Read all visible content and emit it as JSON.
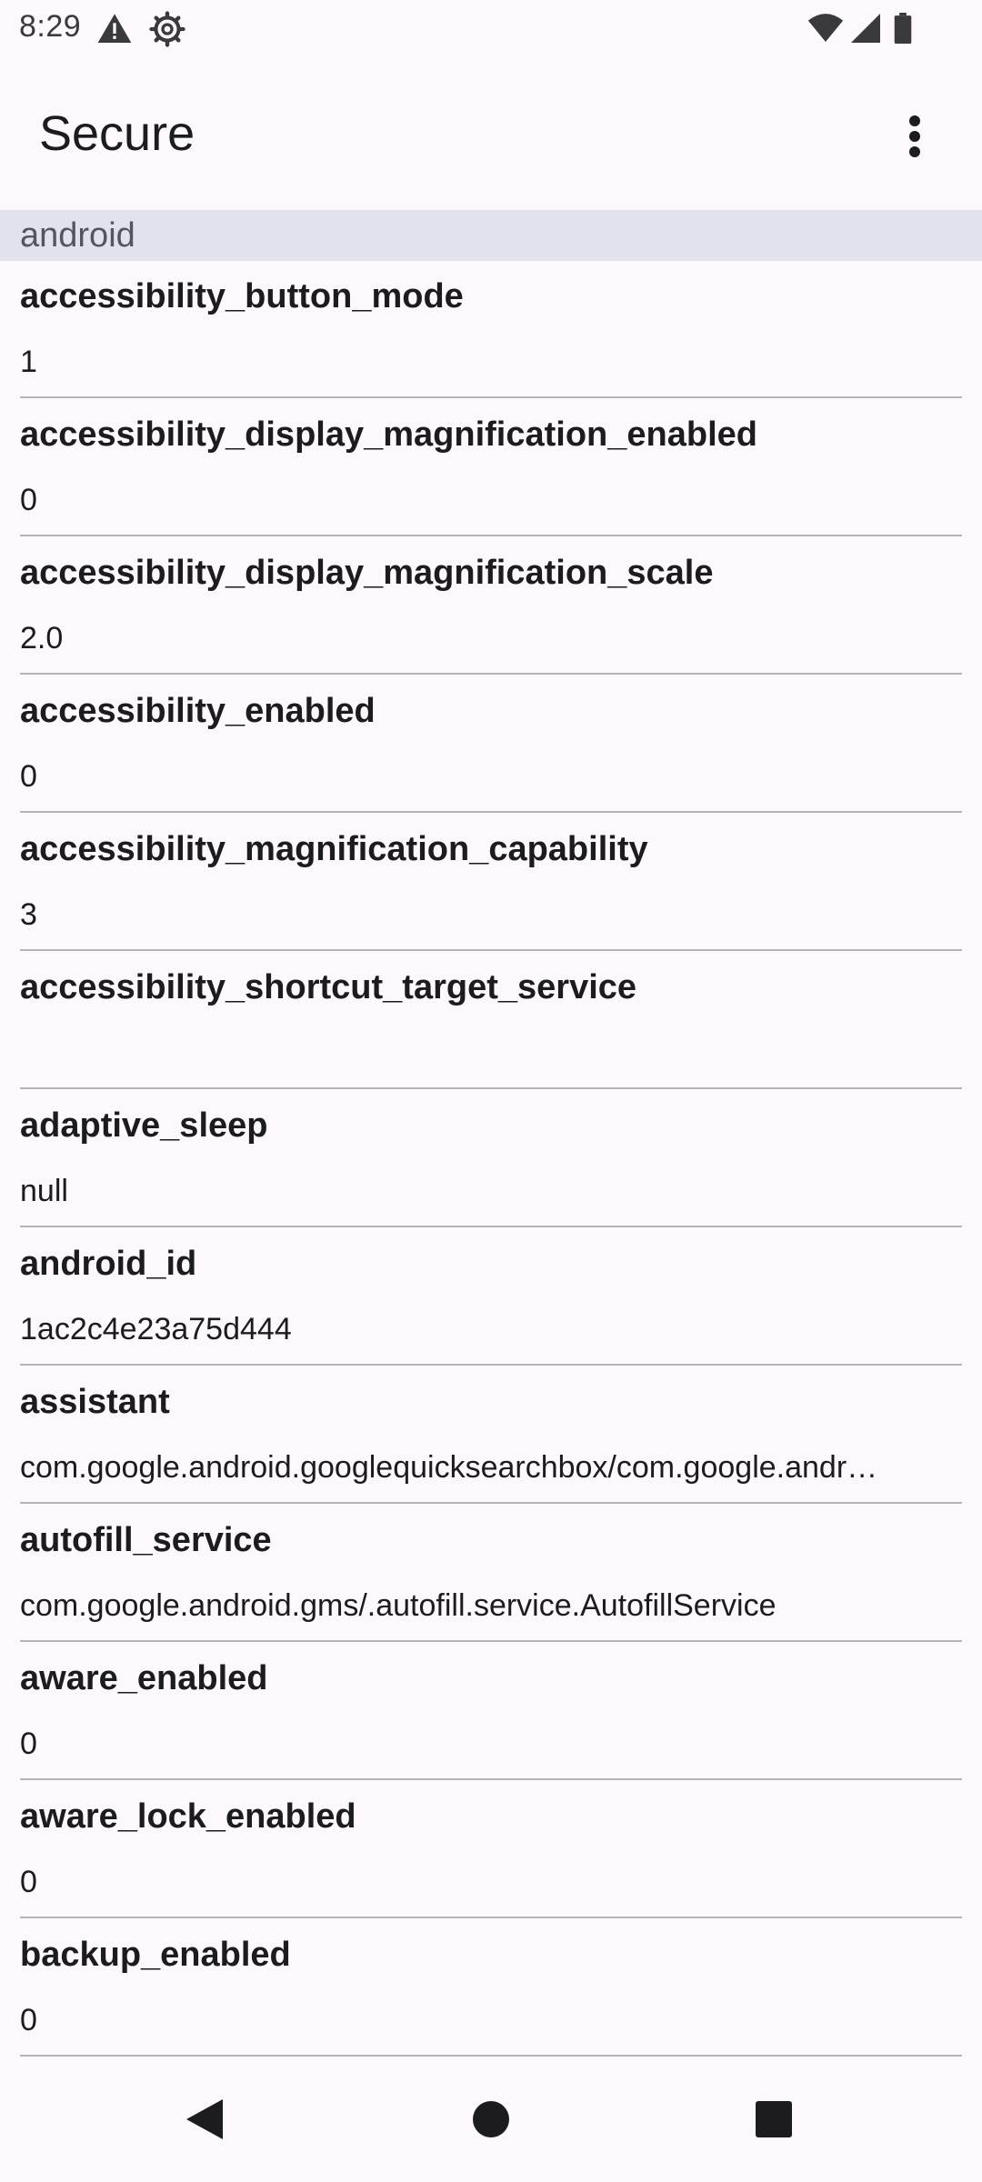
{
  "status_bar": {
    "time": "8:29",
    "left_icons": [
      "alert-icon",
      "settings-gear-icon"
    ],
    "right_icons": [
      "wifi-icon",
      "cellular-signal-icon",
      "battery-icon"
    ]
  },
  "app_bar": {
    "title": "Secure",
    "menu_icon": "more-vert-icon"
  },
  "section": {
    "header": "android"
  },
  "settings": [
    {
      "key": "accessibility_button_mode",
      "value": "1"
    },
    {
      "key": "accessibility_display_magnification_enabled",
      "value": "0"
    },
    {
      "key": "accessibility_display_magnification_scale",
      "value": "2.0"
    },
    {
      "key": "accessibility_enabled",
      "value": "0"
    },
    {
      "key": "accessibility_magnification_capability",
      "value": "3"
    },
    {
      "key": "accessibility_shortcut_target_service",
      "value": ""
    },
    {
      "key": "adaptive_sleep",
      "value": "null"
    },
    {
      "key": "android_id",
      "value": "1ac2c4e23a75d444"
    },
    {
      "key": "assistant",
      "value": "com.google.android.googlequicksearchbox/com.google.andr…"
    },
    {
      "key": "autofill_service",
      "value": "com.google.android.gms/.autofill.service.AutofillService"
    },
    {
      "key": "aware_enabled",
      "value": "0"
    },
    {
      "key": "aware_lock_enabled",
      "value": "0"
    },
    {
      "key": "backup_enabled",
      "value": "0"
    }
  ],
  "nav_bar": {
    "buttons": [
      "back-icon",
      "home-icon",
      "recents-icon"
    ]
  },
  "colors": {
    "background": "#fdf8fc",
    "section_header_bg": "#e1e2ec",
    "divider": "#b3b3b8",
    "text_primary": "#1c1b1f"
  }
}
